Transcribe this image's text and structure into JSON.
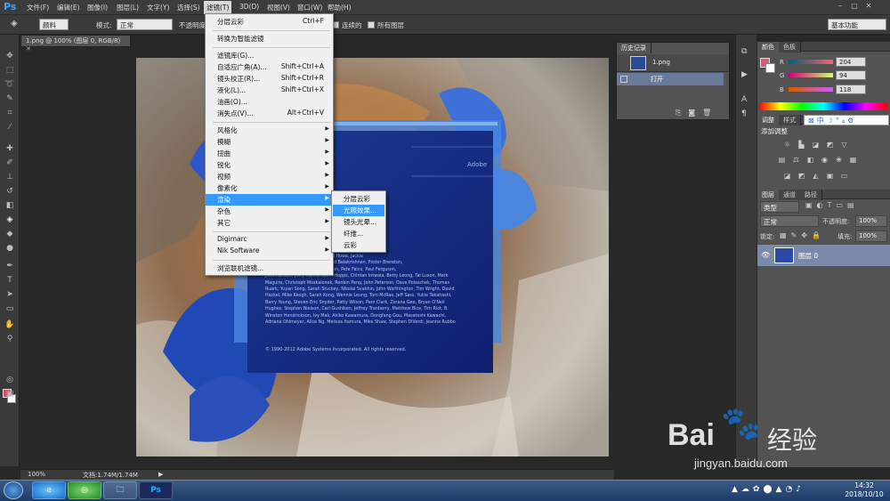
{
  "app": {
    "logo": "Ps",
    "workspace": "基本功能"
  },
  "menubar": {
    "items": [
      "文件(F)",
      "编辑(E)",
      "图像(I)",
      "图层(L)",
      "文字(Y)",
      "选择(S)",
      "滤镜(T)",
      "3D(D)",
      "视图(V)",
      "窗口(W)",
      "帮助(H)"
    ],
    "active": "滤镜(T)"
  },
  "options": {
    "brush_mode": "颜料",
    "mode_label": "模式:",
    "mode_value": "正常",
    "opacity_label": "不透明度",
    "contiguous": "连续的",
    "all_layers": "所有图层"
  },
  "document": {
    "tab": "1.png @ 100% (图层 0, RGB/8)",
    "zoom": "100%",
    "doc_size": "文档:1.74M/1.74M"
  },
  "filter_menu": {
    "items": [
      {
        "label": "分层云彩",
        "shortcut": "Ctrl+F"
      },
      {
        "label": "转换为智能滤镜"
      },
      {
        "label": "滤镜库(G)..."
      },
      {
        "label": "自适应广角(A)...",
        "shortcut": "Shift+Ctrl+A"
      },
      {
        "label": "镜头校正(R)...",
        "shortcut": "Shift+Ctrl+R"
      },
      {
        "label": "液化(L)...",
        "shortcut": "Shift+Ctrl+X"
      },
      {
        "label": "油画(O)..."
      },
      {
        "label": "消失点(V)...",
        "shortcut": "Alt+Ctrl+V"
      },
      {
        "label": "风格化"
      },
      {
        "label": "模糊"
      },
      {
        "label": "扭曲"
      },
      {
        "label": "锐化"
      },
      {
        "label": "视频"
      },
      {
        "label": "像素化"
      },
      {
        "label": "渲染"
      },
      {
        "label": "杂色"
      },
      {
        "label": "其它"
      },
      {
        "label": "Digimarc"
      },
      {
        "label": "Nik Software"
      },
      {
        "label": "浏览联机滤镜..."
      }
    ],
    "highlighted": "渲染"
  },
  "render_submenu": {
    "items": [
      "分层云彩",
      "光照效果...",
      "镜头光晕...",
      "纤维...",
      "云彩"
    ],
    "highlighted": "光照效果..."
  },
  "history": {
    "tabs": [
      "历史记录"
    ],
    "snapshot": "1.png",
    "open": "打开"
  },
  "color": {
    "tabs": [
      "颜色",
      "色板"
    ],
    "r": "204",
    "g": "94",
    "b": "118",
    "fg": "#cc5e76"
  },
  "adjustments": {
    "tabs": [
      "调整",
      "样式"
    ],
    "title": "添加调整"
  },
  "layers": {
    "tabs": [
      "图层",
      "通道",
      "路径"
    ],
    "filter": "类型",
    "blend": "正常",
    "opacity_label": "不透明度:",
    "opacity": "100%",
    "lock_label": "锁定:",
    "fill_label": "填充:",
    "fill": "100%",
    "layer_name": "图层 0"
  },
  "splash": {
    "adobe": "Adobe",
    "credits": "rayanan, Russell Williams, David Howe, Jackie\nn Aubuchon, Barkin Aygun, Vinod Balakrishnan, Foster Brereton,\nYi Cohen, Chris Cox, Alan Erickson, Pete Falco, Paul Ferguson,\nJohn Hanson, Jerry Harris, Kevin Hopps, Chintan Intwala, Betty Leong, Tai Luxon, Mark\nMaguire, Christoph Moskalonek, Renbin Peng, John Peterson, Dave Polaschek, Thomas\nRuark, Yuyan Song, Sarah Stuckey, Nikolai Svakhin, John Worthington, Tim Wright, David\nHackel, Mike Keogh, Sarah Kong, Wennie Leung, Tom McRae, Jeff Sass, Yukie Takahashi,\nBarry Young, Steven Eric Snyder, Patty Wilson, Pam Clark, Zorana Gee, Bryan O'Neil\nHughes, Stephen Nielson, Cari Gushiken, Jeffrey Tranberry, Matthew Bice, Tim Riot, B.\nWinston Hendrickson, Ivy Mak, Akiko Kawamura, Dongfang Gou, Masatoshi Kawachi,\nAdriana Ohlmeyer, Alice Ng, Melissa Itamura, Mike Shaw, Stephen DiVerdi, Jeanne Rubbo",
    "copyright": "© 1990-2012 Adobe Systems Incorporated. All rights reserved."
  },
  "taskbar": {
    "time": "14:32",
    "date": "2018/10/10"
  },
  "watermark": {
    "brand": "Bai",
    "brand2": "经验",
    "url": "jingyan.baidu.com"
  }
}
